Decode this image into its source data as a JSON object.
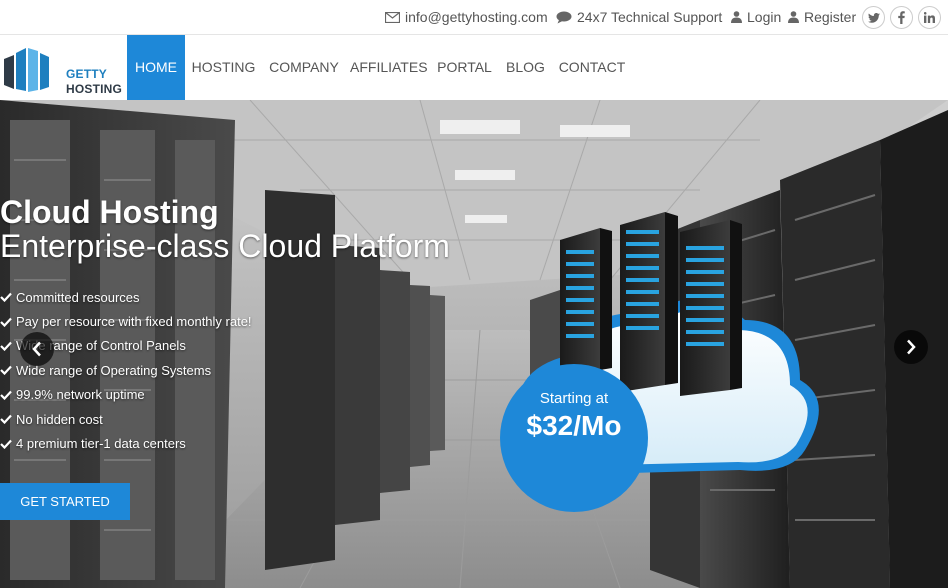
{
  "topbar": {
    "email": "info@gettyhosting.com",
    "support": "24x7 Technical Support",
    "login": "Login",
    "register": "Register",
    "social": [
      "twitter",
      "facebook",
      "linkedin"
    ]
  },
  "brand": {
    "line1": "GETTY",
    "line2": "HOSTING"
  },
  "nav": {
    "items": [
      {
        "label": "HOME",
        "active": true
      },
      {
        "label": "HOSTING"
      },
      {
        "label": "COMPANY"
      },
      {
        "label": "AFFILIATES"
      },
      {
        "label": "PORTAL"
      },
      {
        "label": "BLOG"
      },
      {
        "label": "CONTACT"
      }
    ]
  },
  "hero": {
    "title": "Cloud Hosting",
    "subtitle": "Enterprise-class Cloud Platform",
    "features": [
      "Committed resources",
      "Pay per resource with fixed monthly rate!",
      "Wide range of Control Panels",
      "Wide range of Operating Systems",
      "99.9% network uptime",
      "No hidden cost",
      "4 premium tier-1 data centers"
    ],
    "cta": "GET STARTED",
    "price_caption": "Starting at",
    "price": "$32/Mo"
  },
  "colors": {
    "accent": "#1e88d8",
    "logo_blue": "#1e7fbf",
    "logo_dark": "#2f3b47"
  }
}
